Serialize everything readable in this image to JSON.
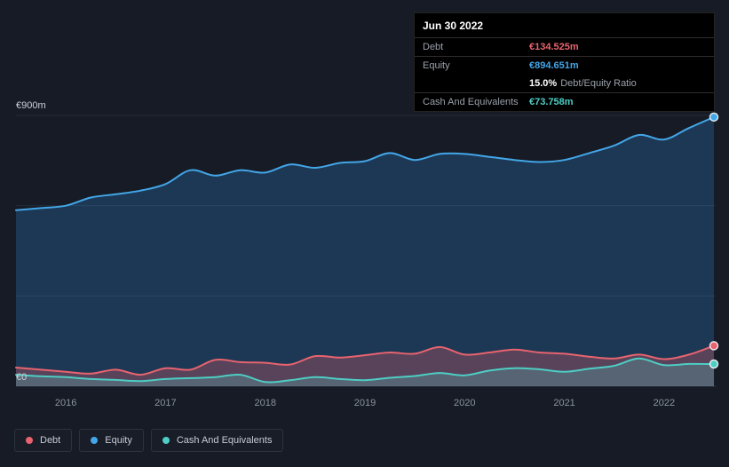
{
  "colors": {
    "background": "#161b25",
    "grid": "#242d3a",
    "zero_line": "#2f3945",
    "axis_text": "#8b94a0",
    "y_label_text": "#ccd2d9",
    "debt": "#e8636f",
    "equity": "#43a6e8",
    "cash": "#4ecdc4",
    "tooltip_bg": "#000000"
  },
  "tooltip": {
    "date": "Jun 30 2022",
    "rows": {
      "debt": {
        "label": "Debt",
        "value": "€134.525m"
      },
      "equity": {
        "label": "Equity",
        "value": "€894.651m"
      },
      "ratio": {
        "percent": "15.0%",
        "text": "Debt/Equity Ratio"
      },
      "cash": {
        "label": "Cash And Equivalents",
        "value": "€73.758m"
      }
    }
  },
  "axis": {
    "y_top_label": "€900m",
    "y_zero_label": "€0",
    "x_tick_labels": [
      "2016",
      "2017",
      "2018",
      "2019",
      "2020",
      "2021",
      "2022"
    ]
  },
  "legend": {
    "items": [
      {
        "label": "Debt"
      },
      {
        "label": "Equity"
      },
      {
        "label": "Cash And Equivalents"
      }
    ]
  },
  "chart_data": {
    "type": "area",
    "x_unit": "year",
    "x": [
      2015.5,
      2015.75,
      2016,
      2016.25,
      2016.5,
      2016.75,
      2017,
      2017.25,
      2017.5,
      2017.75,
      2018,
      2018.25,
      2018.5,
      2018.75,
      2019,
      2019.25,
      2019.5,
      2019.75,
      2020,
      2020.25,
      2020.5,
      2020.75,
      2021,
      2021.25,
      2021.5,
      2021.75,
      2022,
      2022.25,
      2022.5
    ],
    "x_ticks": [
      2016,
      2017,
      2018,
      2019,
      2020,
      2021,
      2022
    ],
    "ylim": [
      0,
      900
    ],
    "y_gridlines": [
      0,
      300,
      600,
      900
    ],
    "y_unit": "€m",
    "legend_position": "bottom-left",
    "series": [
      {
        "name": "Equity",
        "color": "#43a6e8",
        "fill": "rgba(47,125,196,0.30)",
        "values": [
          585,
          592,
          600,
          627,
          638,
          650,
          672,
          718,
          700,
          718,
          710,
          737,
          726,
          742,
          748,
          775,
          752,
          772,
          772,
          762,
          752,
          745,
          752,
          775,
          800,
          835,
          820,
          858,
          894.651
        ]
      },
      {
        "name": "Debt",
        "color": "#e8636f",
        "fill": "rgba(226,94,105,0.30)",
        "values": [
          62,
          55,
          48,
          42,
          55,
          38,
          60,
          55,
          88,
          80,
          78,
          72,
          100,
          95,
          103,
          112,
          108,
          130,
          105,
          112,
          122,
          112,
          108,
          98,
          92,
          105,
          90,
          105,
          134.525
        ]
      },
      {
        "name": "Cash And Equivalents",
        "color": "#4ecdc4",
        "fill": "rgba(78,205,196,0.24)",
        "values": [
          38,
          33,
          30,
          24,
          21,
          17,
          24,
          27,
          30,
          38,
          14,
          20,
          30,
          24,
          20,
          28,
          34,
          44,
          36,
          52,
          60,
          56,
          48,
          58,
          68,
          92,
          70,
          74,
          73.758
        ]
      }
    ],
    "last_values": {
      "Equity": 894.651,
      "Debt": 134.525,
      "Cash And Equivalents": 73.758
    }
  }
}
